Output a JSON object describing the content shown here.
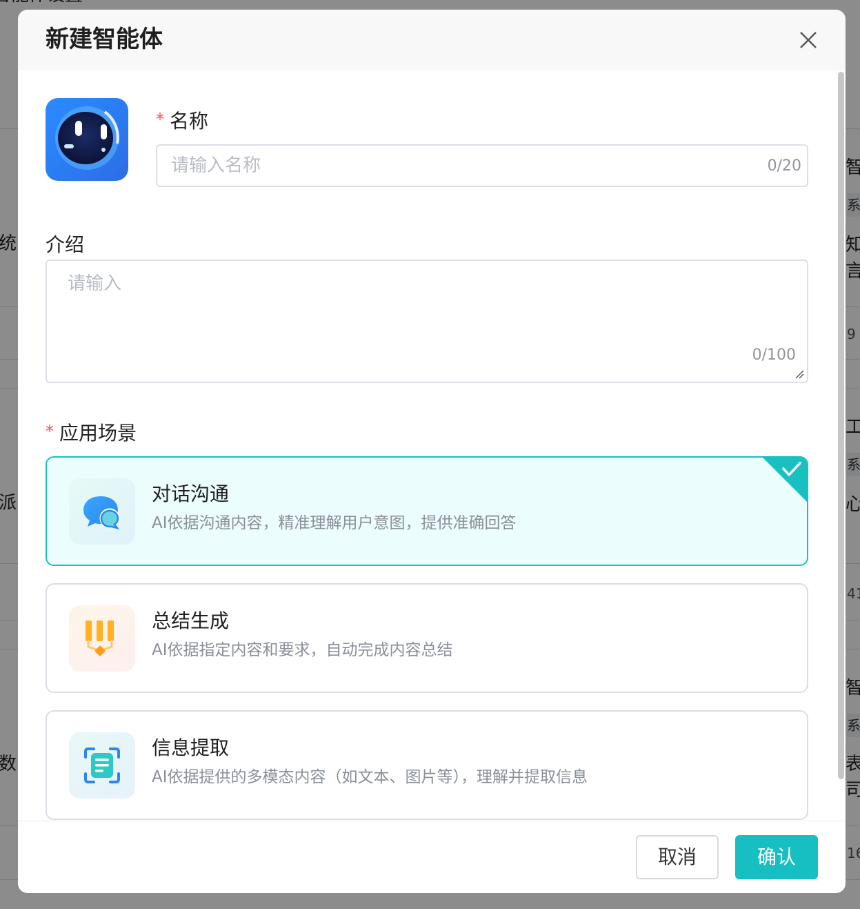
{
  "background": {
    "page_title": "智能体设置",
    "fragments_left": [
      "统的",
      "派",
      "数"
    ],
    "fragments_right": [
      "智",
      "知",
      "言",
      "9",
      "工",
      "心",
      "41",
      "智",
      "表",
      "司",
      "16"
    ],
    "tags": [
      "系",
      "系",
      "系"
    ]
  },
  "modal": {
    "title": "新建智能体",
    "name": {
      "label": "名称",
      "placeholder": "请输入名称",
      "value": "",
      "counter": "0/20"
    },
    "intro": {
      "label": "介绍",
      "placeholder": "请输入",
      "value": "",
      "counter": "0/100"
    },
    "scenario": {
      "label": "应用场景",
      "options": [
        {
          "title": "对话沟通",
          "desc": "AI依据沟通内容，精准理解用户意图，提供准确回答",
          "selected": true,
          "icon": "chat-bubbles-icon"
        },
        {
          "title": "总结生成",
          "desc": "AI依据指定内容和要求，自动完成内容总结",
          "selected": false,
          "icon": "summary-columns-icon"
        },
        {
          "title": "信息提取",
          "desc": "AI依据提供的多模态内容（如文本、图片等），理解并提取信息",
          "selected": false,
          "icon": "scan-document-icon"
        }
      ]
    },
    "buttons": {
      "cancel": "取消",
      "confirm": "确认"
    }
  },
  "colors": {
    "accent": "#17bfc2",
    "required": "#ff4d4f",
    "selected_bg": "#ebfdfd"
  }
}
